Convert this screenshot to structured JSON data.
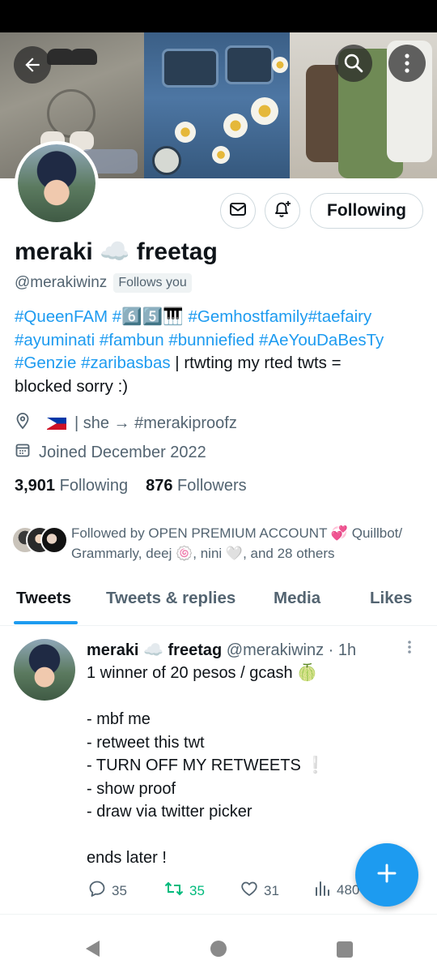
{
  "profile": {
    "display_name": "meraki ☁️ freetag",
    "handle": "@merakiwinz",
    "follows_you": "Follows you",
    "bio_tags_1": [
      "#QueenFAM",
      "#6️⃣5️⃣🎹",
      "#Gemhostfamily",
      "#taefairy"
    ],
    "bio_tags_2": [
      "#ayuminati",
      "#fambun",
      "#bunniefied",
      "#AeYouDaBesTy"
    ],
    "bio_tags_3": [
      "#Genzie",
      "#zaribasbas"
    ],
    "bio_text_tail": " | rtwting my rted twts =",
    "bio_text_last": "blocked sorry :)",
    "location_text": "| she → #merakiproofz",
    "joined": "Joined December 2022",
    "following_count": "3,901",
    "following_label": "Following",
    "followers_count": "876",
    "followers_label": "Followers",
    "followed_by_line1": "Followed by OPEN PREMIUM ACCOUNT 💞 Quillbot/",
    "followed_by_line2": "Grammarly, deej 🍥, nini 🤍, and 28 others"
  },
  "buttons": {
    "following": "Following"
  },
  "tabs": [
    {
      "label": "Tweets",
      "active": true
    },
    {
      "label": "Tweets & replies",
      "active": false
    },
    {
      "label": "Media",
      "active": false
    },
    {
      "label": "Likes",
      "active": false
    }
  ],
  "tweet": {
    "name": "meraki ☁️ freetag",
    "handle_time": "@merakiwinz · 1h",
    "lines": [
      "1 winner of 20 pesos / gcash 🍈",
      "",
      "- mbf me",
      "- retweet this twt",
      "- TURN OFF MY RETWEETS ❕",
      "- show proof",
      "- draw via twitter picker",
      "",
      "ends later !"
    ],
    "replies": "35",
    "retweets": "35",
    "likes": "31",
    "views": "480"
  },
  "icons": {
    "back": "back-arrow-icon",
    "search": "search-icon",
    "more": "more-vertical-icon",
    "message": "envelope-icon",
    "notify": "bell-plus-icon",
    "location": "location-pin-icon",
    "calendar": "calendar-icon",
    "compose": "plus-icon"
  },
  "colors": {
    "accent": "#1d9bf0",
    "retweet_green": "#00ba7c",
    "secondary_text": "#536471"
  }
}
